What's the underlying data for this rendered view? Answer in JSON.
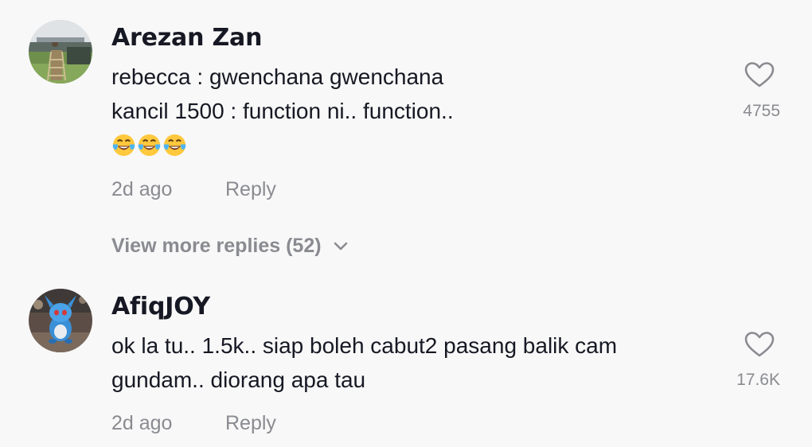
{
  "comments": [
    {
      "username": "Arezan Zan",
      "lines": [
        "rebecca : gwenchana gwenchana",
        "kancil 1500 : function ni.. function.."
      ],
      "emoji_icons": [
        "face-with-tears-of-joy-icon",
        "face-with-tears-of-joy-icon",
        "face-with-tears-of-joy-icon"
      ],
      "likes": "4755",
      "time": "2d ago",
      "reply_label": "Reply",
      "view_more_label": "View more replies (52)"
    },
    {
      "username": "AfiqJOY",
      "lines": [
        "ok la tu.. 1.5k.. siap boleh cabut2 pasang balik cam",
        "gundam.. diorang apa tau"
      ],
      "likes": "17.6K",
      "time": "2d ago",
      "reply_label": "Reply"
    }
  ],
  "colors": {
    "background": "#f8f8f8",
    "primary_text": "#161823",
    "secondary_text": "#8a8b91"
  }
}
